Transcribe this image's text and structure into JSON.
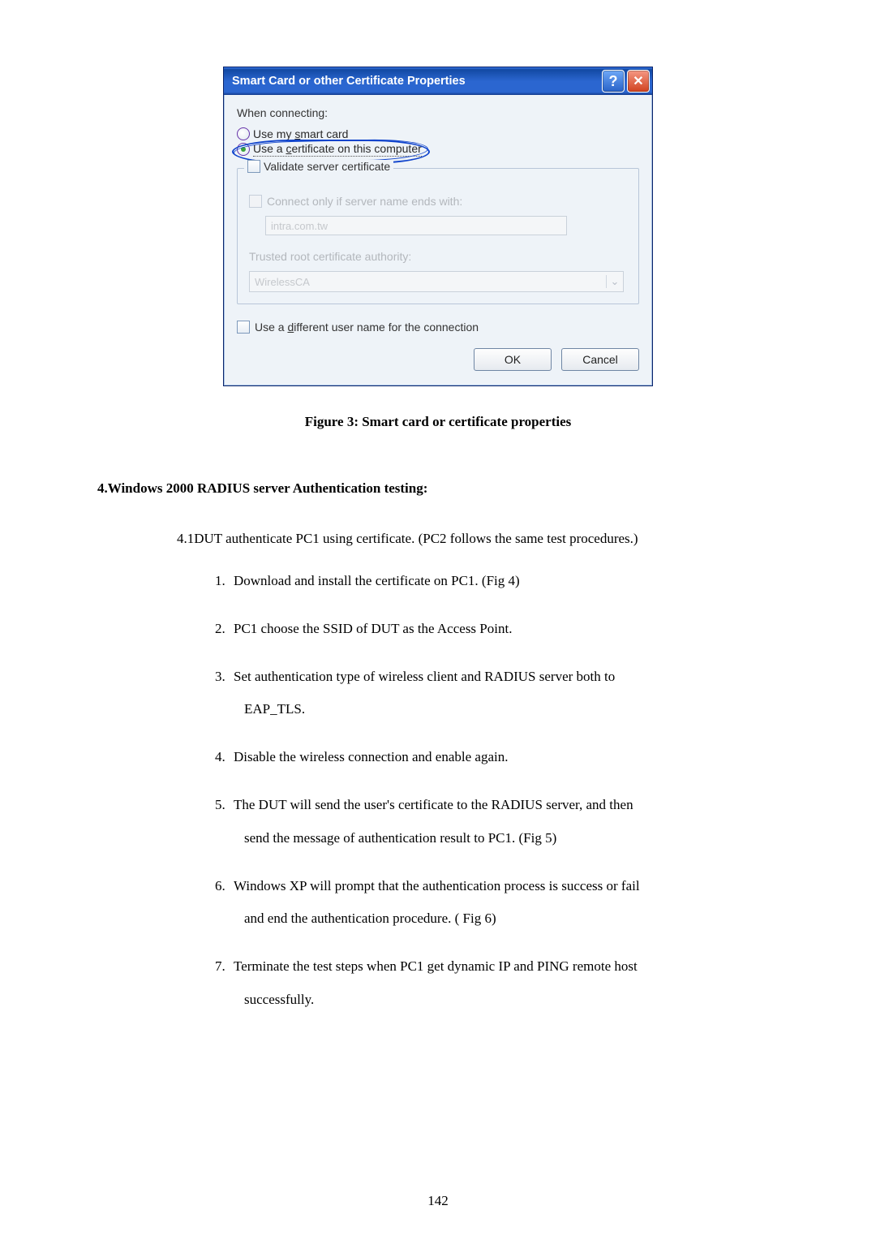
{
  "dialog": {
    "title": "Smart Card or other Certificate Properties",
    "when_connecting": "When connecting:",
    "radio_smart_pre": "Use my ",
    "radio_smart_s": "s",
    "radio_smart_post": "mart card",
    "radio_cert_pre": "Use a ",
    "radio_cert_c": "c",
    "radio_cert_post": "ertificate on this computer",
    "validate_pre": "",
    "validate_v": "V",
    "validate_post": "alidate server certificate",
    "connect_pre": "Connect only if server name ",
    "connect_e": "e",
    "connect_post": "nds with:",
    "server_name_value": "intra.com.tw",
    "trusted_pre": "Trusted ",
    "trusted_r": "r",
    "trusted_post": "oot certificate authority:",
    "combo_value": "WirelessCA",
    "diff_pre": "Use a ",
    "diff_d": "d",
    "diff_post": "ifferent user name for the connection",
    "ok": "OK",
    "cancel": "Cancel",
    "help_glyph": "?",
    "close_glyph": "✕",
    "chev_glyph": "⌄"
  },
  "caption": "Figure 3: Smart card or certificate properties",
  "section_heading": "4.Windows 2000 RADIUS server Authentication testing:",
  "sub41": "4.1DUT authenticate PC1 using certificate. (PC2 follows the same test procedures.)",
  "steps": {
    "s1": "Download and install the certificate on PC1. (Fig 4)",
    "s2": "PC1 choose the SSID of DUT as the Access Point.",
    "s3a": "Set authentication type of wireless client and RADIUS server both to",
    "s3b": "EAP_TLS.",
    "s4": "Disable the wireless connection and enable again.",
    "s5a": "The DUT will send the user's certificate to the RADIUS server, and then",
    "s5b": "send the message of authentication result to PC1. (Fig 5)",
    "s6a": "Windows XP will prompt that the authentication process is success or fail",
    "s6b": "and end the authentication procedure. ( Fig 6)",
    "s7a": "Terminate the test steps when PC1 get dynamic IP and PING remote host",
    "s7b": "successfully."
  },
  "page_number": "142"
}
